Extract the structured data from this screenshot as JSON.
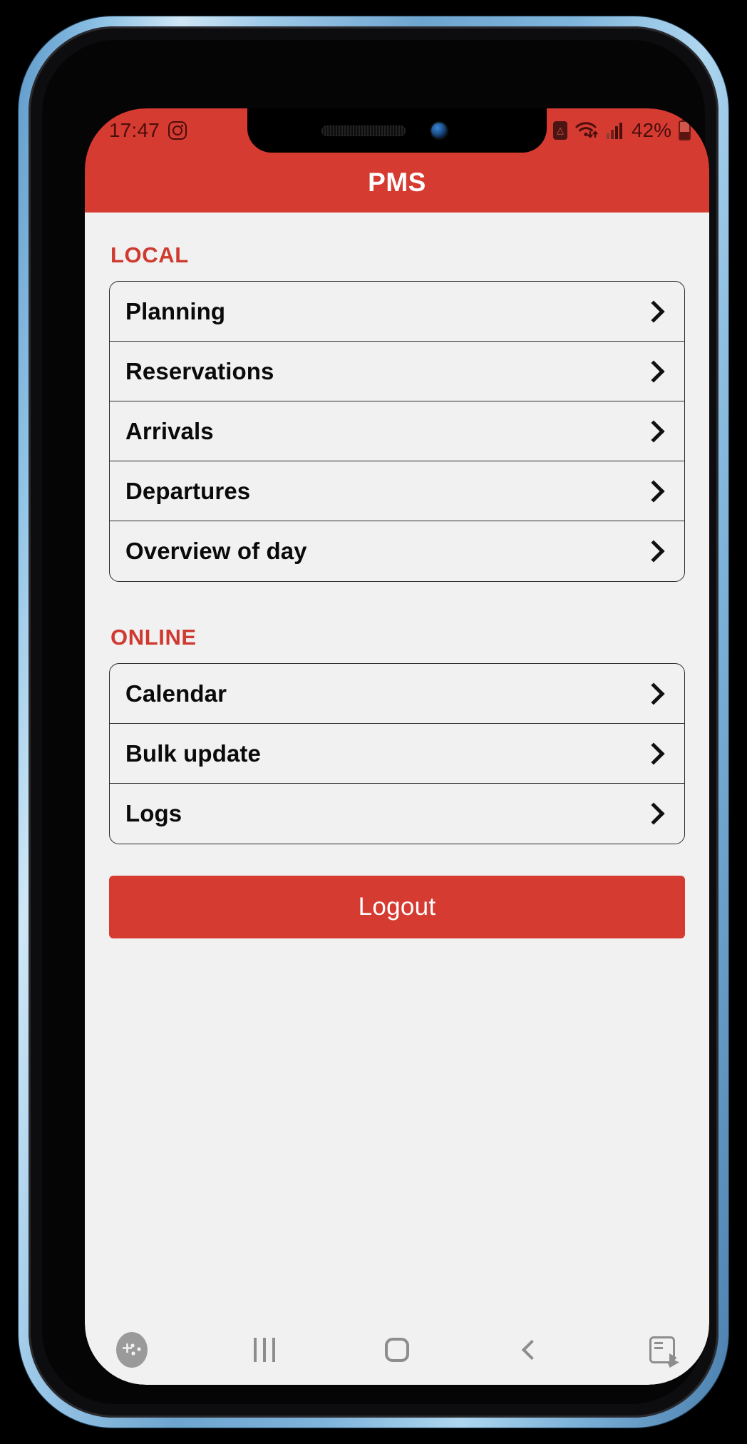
{
  "status_bar": {
    "time": "17:47",
    "left_icons": [
      "instagram-icon"
    ],
    "right_icons": [
      "notification-badge-icon",
      "wifi-icon",
      "signal-icon"
    ],
    "battery_text": "42%",
    "background_color": "#d63b32"
  },
  "app_bar": {
    "title": "PMS",
    "background_color": "#d63b32"
  },
  "sections": [
    {
      "title": "LOCAL",
      "items": [
        {
          "label": "Planning"
        },
        {
          "label": "Reservations"
        },
        {
          "label": "Arrivals"
        },
        {
          "label": "Departures"
        },
        {
          "label": "Overview of day"
        }
      ]
    },
    {
      "title": "ONLINE",
      "items": [
        {
          "label": "Calendar"
        },
        {
          "label": "Bulk update"
        },
        {
          "label": "Logs"
        }
      ]
    }
  ],
  "logout_button": {
    "label": "Logout",
    "color": "#d63b32"
  },
  "nav_bar": {
    "buttons": [
      {
        "name": "game-launcher-icon"
      },
      {
        "name": "recents-icon"
      },
      {
        "name": "home-icon"
      },
      {
        "name": "back-icon"
      },
      {
        "name": "keyboard-switch-icon"
      }
    ]
  },
  "theme": {
    "accent": "#d63b32",
    "section_heading": "#cf3a30",
    "content_bg": "#f1f1f1"
  }
}
